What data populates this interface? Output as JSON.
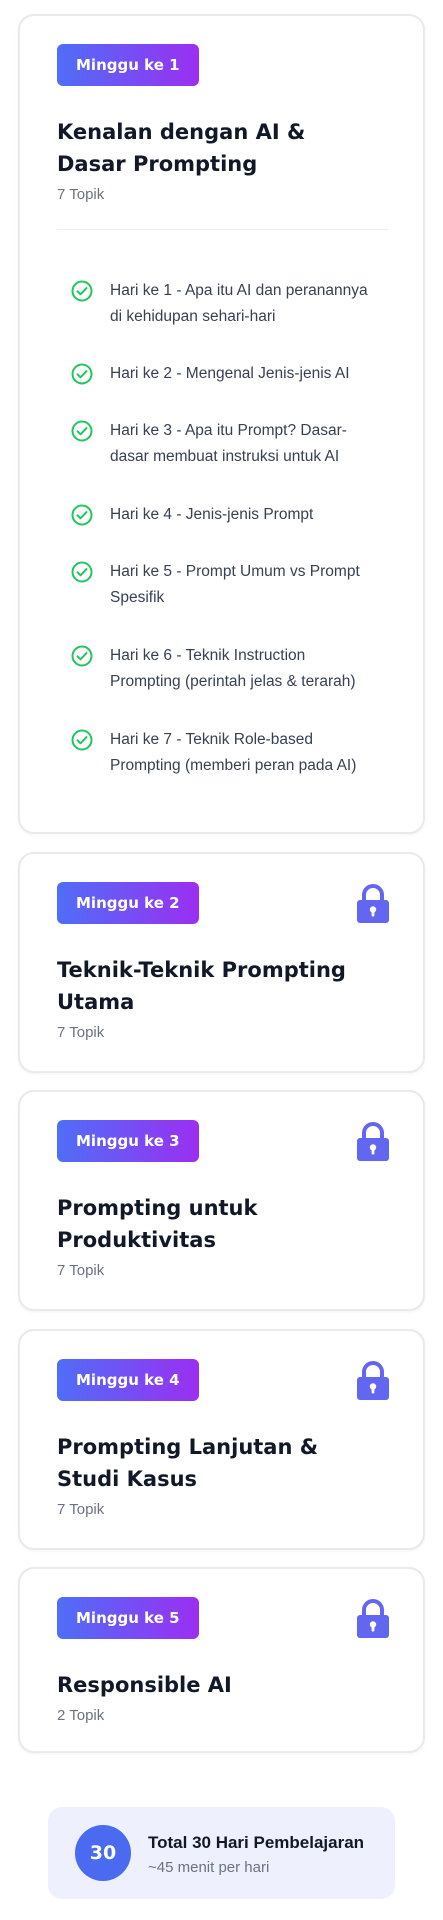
{
  "weeks": [
    {
      "badge": "Minggu ke 1",
      "title": "Kenalan dengan AI & Dasar Prompting",
      "count": "7 Topik",
      "locked": false,
      "topics": [
        "Hari ke 1 - Apa itu AI dan peranannya di kehidupan sehari-hari",
        "Hari ke 2 - Mengenal Jenis-jenis AI",
        "Hari ke 3 - Apa itu Prompt? Dasar-dasar membuat instruksi untuk AI",
        "Hari ke 4 - Jenis-jenis Prompt",
        "Hari ke 5 - Prompt Umum vs Prompt Spesifik",
        "Hari ke 6 - Teknik Instruction Prompting (perintah jelas & terarah)",
        "Hari ke 7 - Teknik Role-based Prompting (memberi peran pada AI)"
      ]
    },
    {
      "badge": "Minggu ke 2",
      "title": "Teknik-Teknik Prompting Utama",
      "count": "7 Topik",
      "locked": true
    },
    {
      "badge": "Minggu ke 3",
      "title": "Prompting untuk Produktivitas",
      "count": "7 Topik",
      "locked": true
    },
    {
      "badge": "Minggu ke 4",
      "title": "Prompting Lanjutan & Studi Kasus",
      "count": "7 Topik",
      "locked": true
    },
    {
      "badge": "Minggu ke 5",
      "title": "Responsible AI",
      "count": "2 Topik",
      "locked": true
    }
  ],
  "summary": {
    "number": "30",
    "title": "Total 30 Hari Pembelajaran",
    "subtitle": "~45 menit per hari"
  },
  "colors": {
    "badge_gradient_start": "#4f6ef7",
    "badge_gradient_end": "#9b2ff2",
    "check_green": "#22c55e",
    "lock_purple": "#6366f1",
    "summary_bg": "#eef0fd",
    "summary_circle": "#4a6bf0"
  },
  "icons": {
    "topic": "check-circle-icon",
    "locked": "lock-icon"
  }
}
